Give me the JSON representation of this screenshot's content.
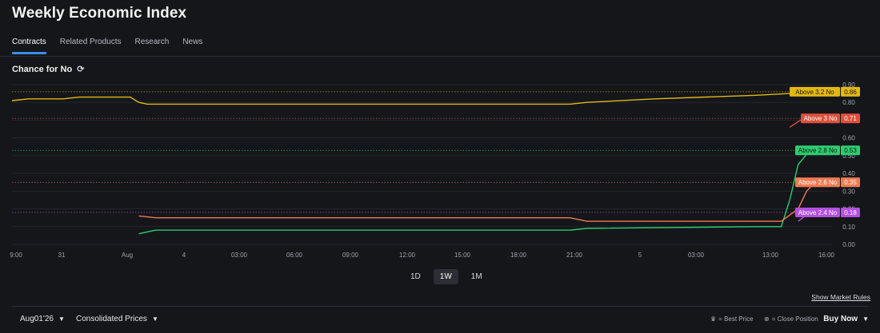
{
  "header": {
    "title": "Weekly Economic Index"
  },
  "tabs": [
    {
      "label": "Contracts",
      "active": true
    },
    {
      "label": "Related Products",
      "active": false
    },
    {
      "label": "Research",
      "active": false
    },
    {
      "label": "News",
      "active": false
    }
  ],
  "section": {
    "title": "Chance for No",
    "refresh_icon": "refresh-icon"
  },
  "chart_data": {
    "type": "line",
    "y_ticks": [
      "0.90",
      "0.80",
      "0.70",
      "0.60",
      "0.50",
      "0.40",
      "0.30",
      "0.20",
      "0.10",
      "0.00"
    ],
    "ylim": [
      0,
      0.9
    ],
    "x_ticks": [
      "9:00",
      "31",
      "Aug",
      "4",
      "03:00",
      "06:00",
      "09:00",
      "12:00",
      "15:00",
      "18:00",
      "21:00",
      "5",
      "03:00",
      "13:00",
      "16:00"
    ],
    "series": [
      {
        "name": "Above 3.2 No",
        "color": "#e2b714",
        "label_color": "#e2b714",
        "label_text_color": "#1b1b1b",
        "value": "0.86",
        "last": 0.86,
        "points": [
          [
            0,
            0.81
          ],
          [
            1,
            0.82
          ],
          [
            2,
            0.82
          ],
          [
            3,
            0.82
          ],
          [
            4,
            0.83
          ],
          [
            5,
            0.83
          ],
          [
            6,
            0.83
          ],
          [
            7,
            0.83
          ],
          [
            7.5,
            0.8
          ],
          [
            8,
            0.79
          ],
          [
            9,
            0.79
          ],
          [
            30,
            0.79
          ],
          [
            33,
            0.79
          ],
          [
            34,
            0.8
          ],
          [
            38,
            0.82
          ],
          [
            44,
            0.84
          ],
          [
            46,
            0.85
          ],
          [
            46.5,
            0.86
          ],
          [
            48.5,
            0.86
          ]
        ]
      },
      {
        "name": "Above 3 No",
        "color": "#e0503d",
        "label_color": "#e0503d",
        "label_text_color": "#ffffff",
        "value": "0.71",
        "last": 0.71,
        "points": [
          [
            46,
            0.66
          ],
          [
            46.8,
            0.71
          ],
          [
            48.5,
            0.71
          ]
        ]
      },
      {
        "name": "Above 2.8 No",
        "color": "#2ecc71",
        "label_color": "#2ecc71",
        "label_text_color": "#0d1a10",
        "value": "0.53",
        "last": 0.53,
        "points": [
          [
            7.5,
            0.06
          ],
          [
            8.5,
            0.08
          ],
          [
            30,
            0.08
          ],
          [
            33,
            0.08
          ],
          [
            34,
            0.09
          ],
          [
            44,
            0.1
          ],
          [
            45.5,
            0.1
          ],
          [
            46,
            0.25
          ],
          [
            46.5,
            0.45
          ],
          [
            47.2,
            0.53
          ],
          [
            48.5,
            0.53
          ]
        ]
      },
      {
        "name": "Above 2.6 No",
        "color": "#f07a52",
        "label_color": "#f07a52",
        "label_text_color": "#ffffff",
        "value": "0.35",
        "last": 0.35,
        "points": [
          [
            7.5,
            0.16
          ],
          [
            8.5,
            0.15
          ],
          [
            30,
            0.15
          ],
          [
            33,
            0.15
          ],
          [
            34,
            0.13
          ],
          [
            45.5,
            0.13
          ],
          [
            46.5,
            0.2
          ],
          [
            47,
            0.3
          ],
          [
            47.5,
            0.35
          ],
          [
            48.5,
            0.35
          ]
        ]
      },
      {
        "name": "Above 2.4 No",
        "color": "#b44fe0",
        "label_color": "#b44fe0",
        "label_text_color": "#ffffff",
        "value": "0.18",
        "last": 0.18,
        "points": [
          [
            46.5,
            0.13
          ],
          [
            47.2,
            0.18
          ],
          [
            48.5,
            0.18
          ]
        ]
      }
    ]
  },
  "range_buttons": [
    {
      "label": "1D",
      "active": false
    },
    {
      "label": "1W",
      "active": true
    },
    {
      "label": "1M",
      "active": false
    }
  ],
  "links": {
    "market_rules": "Show Market Rules"
  },
  "footer": {
    "date_select": "Aug01'26",
    "price_select": "Consolidated Prices",
    "legend_best": "= Best Price",
    "legend_best_icon": "crown-icon",
    "legend_close": "= Close Position",
    "legend_close_icon": "close-position-icon",
    "buy_label": "Buy Now"
  }
}
